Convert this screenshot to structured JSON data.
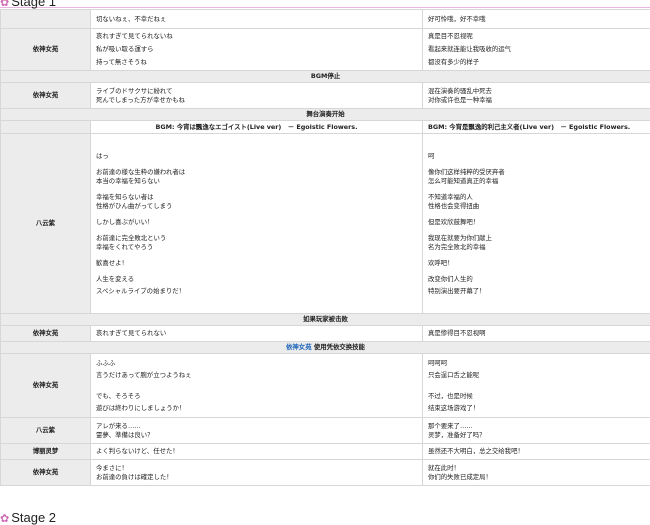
{
  "stage1_title": "Stage 1",
  "stage2_title": "Stage 2",
  "rows": {
    "r1": {
      "ja": [
        "切ないねぇ、不幸だねぇ"
      ],
      "zh": [
        "好可怜哦，好不幸哦"
      ]
    },
    "r2": {
      "speaker": "依神女苑",
      "ja": [
        "哀れすぎて見てられないね",
        "私が吸い取る運すら",
        "持って無さそうね"
      ],
      "zh": [
        "真是目不忍视呢",
        "看起来就连能让我吸收的运气",
        "都没有多少的样子"
      ]
    },
    "banner_bgm_stop": "BGM停止",
    "r3": {
      "speaker": "依神女苑",
      "ja": [
        "ライブのドサクサに紛れて",
        "死んでしまった方が幸せかもね"
      ],
      "zh": [
        "混在演奏的骚乱中死去",
        "对你或许也是一种幸福"
      ]
    },
    "banner_stage_start": "舞台演奏开始",
    "bgm_ja": "BGM: 今宵は飄逸なエゴイスト(Live ver)　－ Egoistic Flowers.",
    "bgm_zh": "BGM: 今宵是飘逸的利己主义者(Live ver)　－ Egoistic Flowers.",
    "r4": {
      "speaker": "八云紫",
      "ja": [
        "はっ",
        "お前達の様な生粋の嫌われ者は",
        "本当の幸福を知らない",
        "",
        "幸福を知らない者は",
        "性格がひん曲がってしまう",
        "",
        "しかし喜ぶがいい！",
        "",
        "お前達に完全敗北という",
        "幸福をくれてやろう",
        "",
        "歓喜せよ！",
        "",
        "人生を変える",
        "スペシャルライブの始まりだ！"
      ],
      "zh": [
        "呵",
        "像你们这样纯粹的受厌弃者",
        "怎么可能知道真正的幸福",
        "",
        "不知道幸福的人",
        "性格也会变得扭曲",
        "",
        "但是欢欣鼓舞吧！",
        "",
        "我现在就要为你们献上",
        "名为完全败北的幸福",
        "",
        "欢呼吧！",
        "",
        "改变你们人生的",
        "特别演出要开幕了！"
      ]
    },
    "banner_lose": "如果玩家被击败",
    "r5": {
      "speaker": "依神女苑",
      "ja": [
        "哀れすぎて見てられない"
      ],
      "zh": [
        "真是惨得目不忍视啊"
      ]
    },
    "banner_swap_name": "依神女苑",
    "banner_swap_rest": " 使用凭依交换技能",
    "r6": {
      "speaker": "依神女苑",
      "ja": [
        "ふふふ",
        "言うだけあって腕が立つようねぇ",
        "",
        "でも、そろそろ",
        "遊びは終わりにしましょうか！"
      ],
      "zh": [
        "呵呵呵",
        "只会逞口舌之能呢",
        "",
        "不过，也是时候",
        "结束这场游戏了！"
      ]
    },
    "r7": {
      "speaker": "八云紫",
      "ja": [
        "アレが来る……",
        "霊夢、準備は良い？"
      ],
      "zh": [
        "那个要来了……",
        "灵梦，准备好了吗？"
      ]
    },
    "r8": {
      "speaker": "博丽灵梦",
      "ja": [
        "よく判らないけど、任せた！"
      ],
      "zh": [
        "虽然还不大明白，总之交给我吧！"
      ]
    },
    "r9": {
      "speaker": "依神女苑",
      "ja": [
        "今まさに！",
        "お前達の負けは確定した！"
      ],
      "zh": [
        "就在此时！",
        "你们的失败已成定局！"
      ]
    }
  }
}
